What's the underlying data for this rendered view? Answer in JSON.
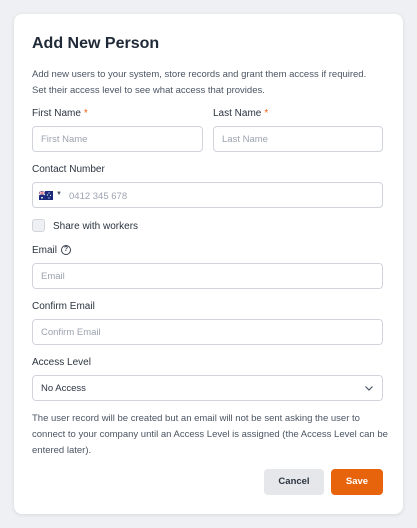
{
  "dialog": {
    "title": "Add New Person",
    "description": "Add new users to your system, store records and grant them access if required. Set their access level to see what access that provides."
  },
  "form": {
    "first_name": {
      "label": "First Name",
      "required_mark": "*",
      "placeholder": "First Name",
      "value": ""
    },
    "last_name": {
      "label": "Last Name",
      "required_mark": "*",
      "placeholder": "Last Name",
      "value": ""
    },
    "contact_number": {
      "label": "Contact Number",
      "country_flag": "australia-flag-icon",
      "placeholder": "0412 345 678",
      "value": ""
    },
    "share_with_workers": {
      "label": "Share with workers",
      "checked": false
    },
    "email": {
      "label": "Email",
      "help_icon": "?",
      "placeholder": "Email",
      "value": ""
    },
    "confirm_email": {
      "label": "Confirm Email",
      "placeholder": "Confirm Email",
      "value": ""
    },
    "access_level": {
      "label": "Access Level",
      "selected": "No Access"
    },
    "note": "The user record will be created but an email will not be sent asking the user to connect to your company until an Access Level is assigned (the Access Level can be entered later)."
  },
  "actions": {
    "cancel_label": "Cancel",
    "save_label": "Save"
  },
  "colors": {
    "accent": "#e8640c",
    "required": "#e8640c",
    "cancel_bg": "#e5e7eb"
  }
}
